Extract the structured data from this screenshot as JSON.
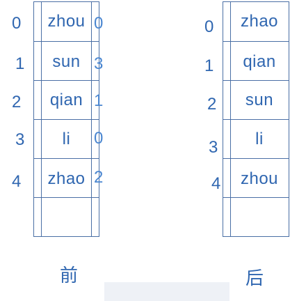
{
  "before": {
    "indices": [
      "0",
      "1",
      "2",
      "3",
      "4"
    ],
    "cells": [
      "zhou",
      "sun",
      "qian",
      "li",
      "zhao"
    ],
    "side_values": [
      "0",
      "3",
      "1",
      "0",
      "2"
    ],
    "caption": "前"
  },
  "after": {
    "indices": [
      "0",
      "1",
      "2",
      "3",
      "4"
    ],
    "cells": [
      "zhao",
      "qian",
      "sun",
      "li",
      "zhou"
    ],
    "caption": "后"
  },
  "colors": {
    "line": "#4a6fa5",
    "text": "#2f66b0"
  }
}
